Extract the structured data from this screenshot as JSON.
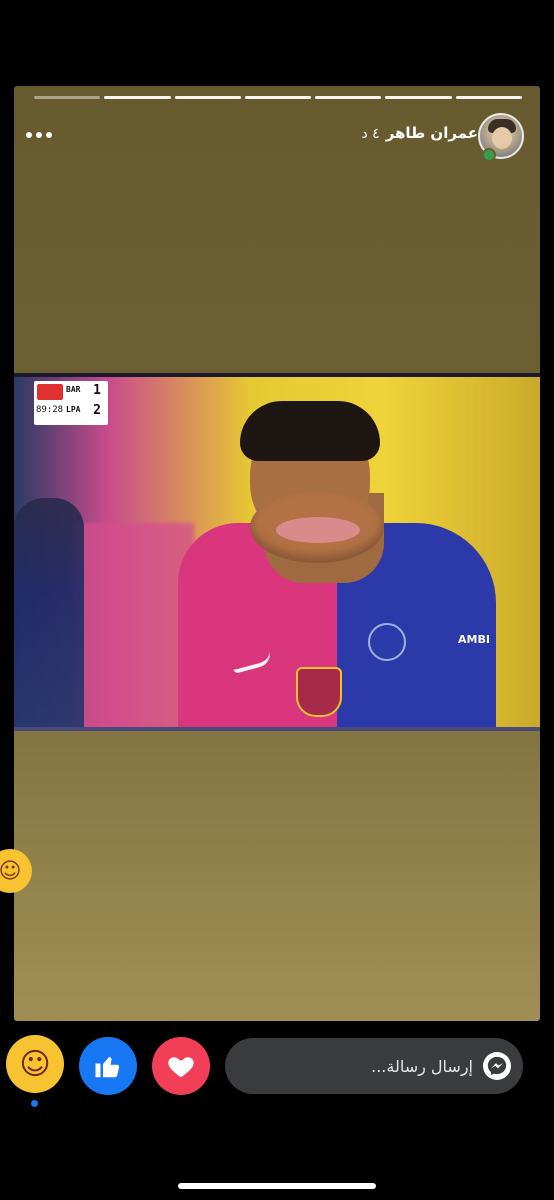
{
  "story": {
    "progress": {
      "segments": 7,
      "viewed": 1
    },
    "user": {
      "name": "عمران طاهر",
      "time": "٤ د"
    },
    "scoreboard": {
      "team1": "BAR",
      "team2": "LPA",
      "score1": "1",
      "score2": "2",
      "clock": "89:28"
    },
    "kit_text": "AMBI"
  },
  "bottom": {
    "message_placeholder": "إرسال رسالة...",
    "icons": {
      "haha": "haha-emoji",
      "like": "thumbs-up-icon",
      "love": "heart-icon",
      "messenger": "messenger-icon"
    }
  },
  "colors": {
    "like": "#1877f2",
    "love": "#f33e58",
    "haha": "#f7c330",
    "message_bg": "#3a3b3c"
  }
}
